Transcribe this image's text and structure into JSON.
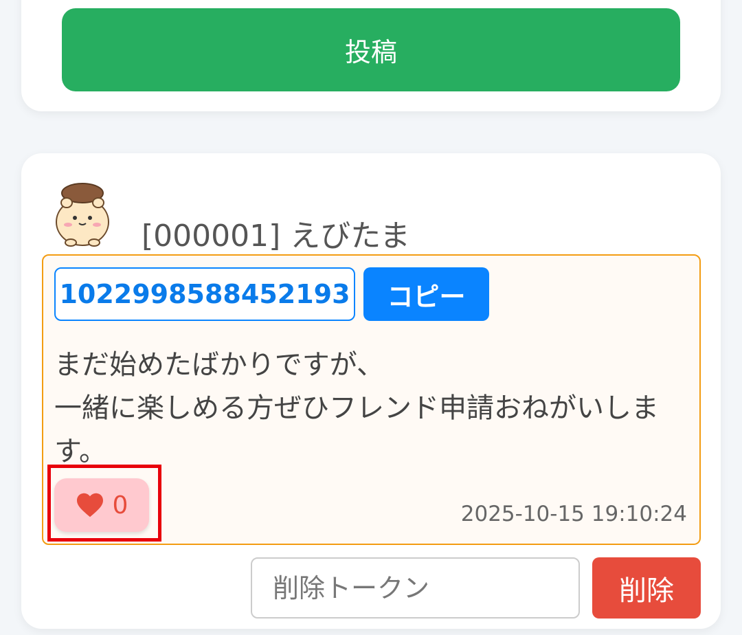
{
  "compose": {
    "post_label": "投稿"
  },
  "post": {
    "author": "[000001] えびたま",
    "friend_code": "1022998588452193",
    "copy_label": "コピー",
    "message": "まだ始めたばかりですが、\n一緒に楽しめる方ぜひフレンド申請おねがいします。",
    "like_count": "0",
    "timestamp": "2025-10-15 19:10:24",
    "delete_token_placeholder": "削除トークン",
    "delete_label": "削除"
  },
  "icons": {
    "like": "heart-icon",
    "avatar": "hamster-avatar"
  },
  "colors": {
    "post_button": "#27ae60",
    "copy_button": "#0a84ff",
    "delete_button": "#e74c3c",
    "like_bg": "#ffc9cf",
    "post_border": "#f39c12"
  }
}
